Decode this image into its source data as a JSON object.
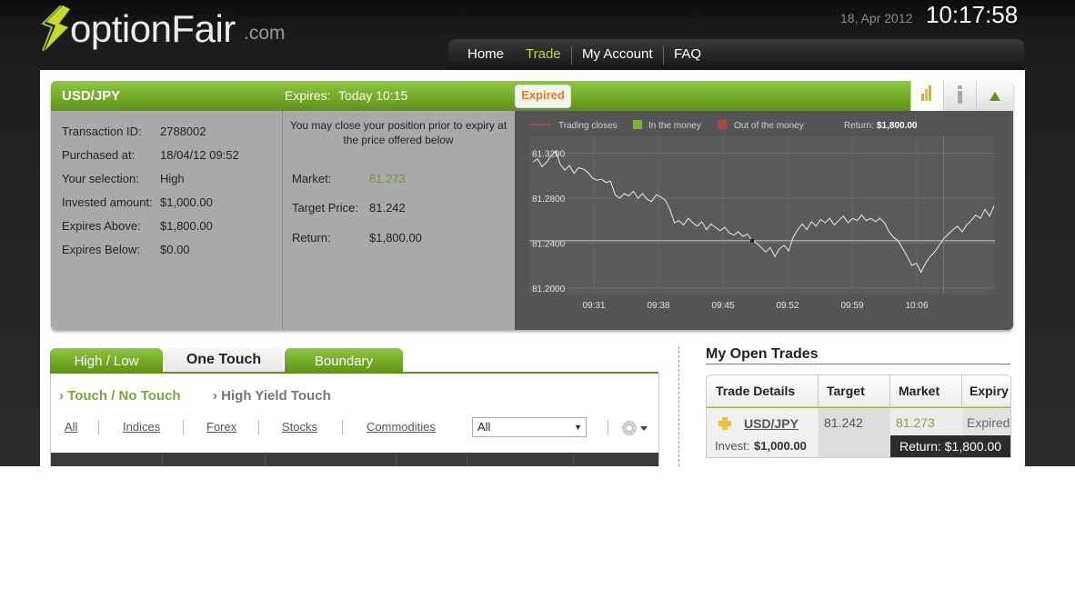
{
  "brand": {
    "logo_text": "optionFair",
    "logo_suffix": ".com"
  },
  "header": {
    "date": "18, Apr 2012",
    "time": "10:17:58"
  },
  "nav": {
    "items": [
      {
        "label": "Home"
      },
      {
        "label": "Trade"
      },
      {
        "label": "My Account"
      },
      {
        "label": "FAQ"
      }
    ],
    "active": "Trade"
  },
  "position": {
    "pair": "USD/JPY",
    "expires_label": "Expires:",
    "expires_value": "Today 10:15",
    "status": "Expired",
    "details": [
      {
        "label": "Transaction ID:",
        "value": "2788002"
      },
      {
        "label": "Purchased at:",
        "value": "18/04/12 09:52"
      },
      {
        "label": "Your selection:",
        "value": "High"
      },
      {
        "label": "Invested amount:",
        "value": "$1,000.00"
      },
      {
        "label": "Expires Above:",
        "value": "$1,800.00"
      },
      {
        "label": "Expires Below:",
        "value": "$0.00"
      }
    ],
    "close_note": "You may close your position prior to expiry at the price offered below",
    "close_rows": [
      {
        "label": "Market:",
        "value": "81.273"
      },
      {
        "label": "Target Price:",
        "value": "81.242"
      },
      {
        "label": "Return:",
        "value": "$1,800.00"
      }
    ]
  },
  "chart_data": {
    "type": "line",
    "legend": [
      {
        "label": "Trading closes",
        "color": "#d9532f"
      },
      {
        "label": "In the money",
        "color": "#7ab03a"
      },
      {
        "label": "Out of the money",
        "color": "#a8493a"
      }
    ],
    "return_label": "Return:",
    "return_value": "$1,800.00",
    "x_ticks": [
      "09:31",
      "09:38",
      "09:45",
      "09:52",
      "09:59",
      "10:06"
    ],
    "y_ticks": [
      "81.3200",
      "81.2800",
      "81.2400",
      "81.2000"
    ],
    "ylim": [
      81.195,
      81.335
    ],
    "target": 81.242,
    "trading_closes": "10:15",
    "series": [
      {
        "values": [
          81.312,
          81.315,
          81.308,
          81.312,
          81.318,
          81.322,
          81.31,
          81.305,
          81.309,
          81.302,
          81.307,
          81.306,
          81.303,
          81.298,
          81.296,
          81.297,
          81.294,
          81.295,
          81.283,
          81.28,
          81.284,
          81.282,
          81.286,
          81.28,
          81.284,
          81.279,
          81.277,
          81.283,
          81.281,
          81.278,
          81.27,
          81.258,
          81.26,
          81.256,
          81.262,
          81.258,
          81.255,
          81.259,
          81.252,
          81.257,
          81.254,
          81.251,
          81.254,
          81.249,
          81.247,
          81.25,
          81.246,
          81.248,
          81.242,
          81.24,
          81.236,
          81.232,
          81.236,
          81.228,
          81.235,
          81.238,
          81.233,
          81.245,
          81.252,
          81.257,
          81.252,
          81.259,
          81.255,
          81.261,
          81.258,
          81.262,
          81.256,
          81.26,
          81.264,
          81.258,
          81.262,
          81.26,
          81.265,
          81.26,
          81.262,
          81.259,
          81.262,
          81.258,
          81.25,
          81.245,
          81.242,
          81.235,
          81.228,
          81.22,
          81.222,
          81.214,
          81.222,
          81.228,
          81.232,
          81.238,
          81.244,
          81.248,
          81.252,
          81.255,
          81.25,
          81.256,
          81.26,
          81.265,
          81.262,
          81.27,
          81.264,
          81.273
        ]
      }
    ]
  },
  "tabs": [
    {
      "label": "High / Low"
    },
    {
      "label": "One Touch"
    },
    {
      "label": "Boundary"
    }
  ],
  "active_tab": "One Touch",
  "subtabs": [
    {
      "label": "Touch / No Touch"
    },
    {
      "label": "High Yield Touch"
    }
  ],
  "filters": [
    {
      "label": "All"
    },
    {
      "label": "Indices"
    },
    {
      "label": "Forex"
    },
    {
      "label": "Stocks"
    },
    {
      "label": "Commodities"
    }
  ],
  "asset_select": {
    "value": "All"
  },
  "open_trades": {
    "title": "My Open Trades",
    "headers": [
      "Trade Details",
      "Target",
      "Market",
      "Expiry"
    ],
    "row": {
      "asset": "USD/JPY",
      "target": "81.242",
      "market": "81.273",
      "expiry": "Expired",
      "invest_label": "Invest:",
      "invest_value": "$1,000.00",
      "return_text": "Return: $1,800.00"
    }
  },
  "colors": {
    "brand_green": "#7ab03a",
    "accent_yellow": "#c7d33f",
    "expired_orange": "#e67e22",
    "market_green": "#7aa832"
  }
}
